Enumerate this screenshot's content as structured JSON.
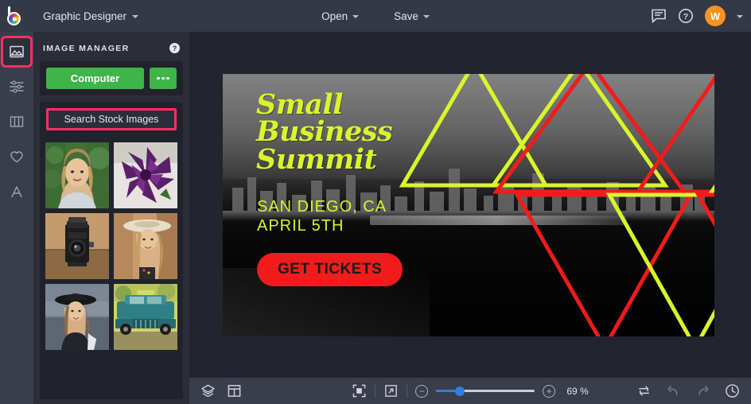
{
  "app": {
    "logo_name": "befunky-logo",
    "document_title": "Graphic Designer",
    "accent_pink": "#ff2e63",
    "accent_green": "#3eb44b",
    "accent_orange": "#f79321",
    "accent_blue": "#2f7fe0"
  },
  "topbar": {
    "open_label": "Open",
    "save_label": "Save",
    "chat_icon": "chat-bubble-icon",
    "help_icon": "help-circle-icon",
    "avatar_initial": "W"
  },
  "rail": {
    "items": [
      {
        "icon": "image-icon",
        "name": "image-manager",
        "active": true
      },
      {
        "icon": "sliders-icon",
        "name": "edit-tools",
        "active": false
      },
      {
        "icon": "columns-icon",
        "name": "templates",
        "active": false
      },
      {
        "icon": "heart-icon",
        "name": "favorites",
        "active": false
      },
      {
        "icon": "text-a-icon",
        "name": "text-tool",
        "active": false
      }
    ]
  },
  "panel": {
    "title": "IMAGE MANAGER",
    "help_icon": "help-circle-icon",
    "computer_label": "Computer",
    "more_label": "more-options",
    "stock_label": "Search Stock Images",
    "thumbnails": [
      {
        "name": "woman-smiling-greenery",
        "alt": "Smiling blonde woman in front of green hedge"
      },
      {
        "name": "purple-flower",
        "alt": "Purple dahlia flower on white plate"
      },
      {
        "name": "vintage-camera",
        "alt": "Vintage twin lens camera on wood table"
      },
      {
        "name": "woman-sun-hat",
        "alt": "Woman wearing a wide brim sun hat"
      },
      {
        "name": "woman-black-hat",
        "alt": "Woman in black fedora hat"
      },
      {
        "name": "teal-vintage-truck",
        "alt": "Teal vintage pickup truck"
      }
    ]
  },
  "canvas": {
    "headline": [
      "Small",
      "Business",
      "Summit"
    ],
    "subline": [
      "SAN DIEGO, CA",
      "APRIL 5TH"
    ],
    "cta_label": "GET TICKETS",
    "headline_color": "#d9f52b",
    "cta_bg": "#f21b1b",
    "triangle_colors": [
      "#d9f52b",
      "#f21b1b"
    ],
    "background_alt": "Aerial grayscale photo of a city harbor skyline"
  },
  "bottombar": {
    "layers_icon": "layers-icon",
    "template_icon": "template-grid-icon",
    "fit_icon": "fit-to-screen-icon",
    "expand_icon": "expand-arrow-icon",
    "zoom_out_label": "−",
    "zoom_in_label": "+",
    "zoom_value": "69 %",
    "swap_icon": "swap-arrows-icon",
    "undo_icon": "undo-arrow-icon",
    "redo_icon": "redo-arrow-icon",
    "history_icon": "clock-history-icon"
  }
}
